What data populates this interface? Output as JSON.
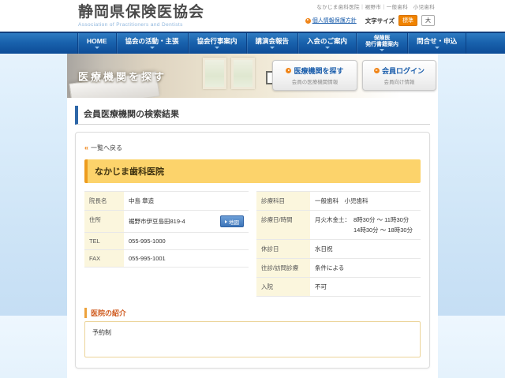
{
  "header": {
    "site_title": "静岡県保険医協会",
    "site_subtitle": "Association of Practitioners and Dentists",
    "breadcrumb": "なかじま歯科医院｜裾野市｜一般歯科　小児歯科",
    "privacy_link": "個人情報保護方針",
    "font_size_label": "文字サイズ",
    "font_size_standard": "標準",
    "font_size_large": "大"
  },
  "nav": {
    "items": [
      {
        "label": "HOME"
      },
      {
        "label": "協会の活動・主張"
      },
      {
        "label": "協会行事案内"
      },
      {
        "label": "講演会報告"
      },
      {
        "label": "入会のご案内"
      },
      {
        "label": "保険医",
        "label2": "発行書籍案内"
      },
      {
        "label": "問合せ・申込"
      }
    ]
  },
  "hero": {
    "banner_title": "医療機関を探す",
    "buttons": [
      {
        "title": "医療機関を探す",
        "subtitle": "会員の医療機関情報"
      },
      {
        "title": "会員ログイン",
        "subtitle": "会員向け情報"
      }
    ]
  },
  "main": {
    "page_title": "会員医療機関の検索結果",
    "back_link": "一覧へ戻る",
    "clinic_name": "なかじま歯科医院",
    "info_left": [
      {
        "label": "院長名",
        "value": "中島 章造"
      },
      {
        "label": "住所",
        "value": "裾野市伊豆島田819-4",
        "button": "地図"
      },
      {
        "label": "TEL",
        "value": "055-995-1000"
      },
      {
        "label": "FAX",
        "value": "055-995-1001"
      }
    ],
    "info_right": [
      {
        "label": "診療科目",
        "value": "一般歯科　小児歯科"
      },
      {
        "label": "診療日/時間",
        "days": "月火木金土：",
        "time1": "8時30分 ～ 11時30分",
        "time2": "14時30分 ～ 18時30分"
      },
      {
        "label": "休診日",
        "value": "水日祝"
      },
      {
        "label": "往診/訪問診療",
        "value": "条件による"
      },
      {
        "label": "入院",
        "value": "不可"
      }
    ],
    "intro_title": "医院の紹介",
    "intro_body": "予約制"
  },
  "icons": {
    "back": "«"
  },
  "colors": {
    "nav_blue": "#1962ad",
    "accent_orange": "#f08519",
    "highlight_yellow": "#fcd36b",
    "link_blue": "#1a5dab",
    "label_cell_yellow": "#fbf6dd"
  }
}
